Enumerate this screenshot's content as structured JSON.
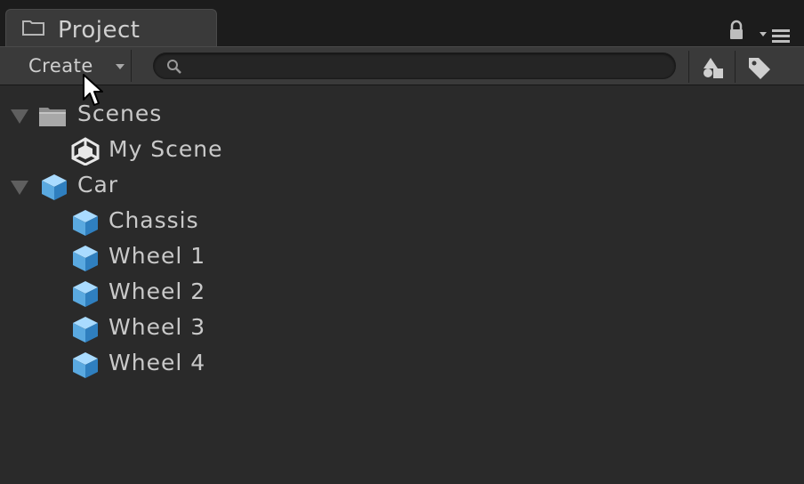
{
  "tab": {
    "title": "Project",
    "icon": "folder-icon"
  },
  "header_icons": [
    "lock-icon",
    "panel-menu-icon"
  ],
  "toolbar": {
    "create_label": "Create",
    "search": {
      "value": "",
      "placeholder": ""
    },
    "buttons": [
      "filter-by-type-icon",
      "filter-by-label-icon"
    ]
  },
  "tree": [
    {
      "label": "Scenes",
      "icon": "folder-icon",
      "level": 0,
      "expanded": true
    },
    {
      "label": "My Scene",
      "icon": "unity-scene-icon",
      "level": 1
    },
    {
      "label": "Car",
      "icon": "prefab-cube-icon",
      "level": 0,
      "expanded": true
    },
    {
      "label": "Chassis",
      "icon": "prefab-cube-icon",
      "level": 1
    },
    {
      "label": "Wheel 1",
      "icon": "prefab-cube-icon",
      "level": 1
    },
    {
      "label": "Wheel 2",
      "icon": "prefab-cube-icon",
      "level": 1
    },
    {
      "label": "Wheel 3",
      "icon": "prefab-cube-icon",
      "level": 1
    },
    {
      "label": "Wheel 4",
      "icon": "prefab-cube-icon",
      "level": 1
    }
  ],
  "colors": {
    "background": "#2a2a2a",
    "toolbar": "#3a3a3a",
    "text": "#c9c9c9",
    "cube": "#5fb3e8"
  }
}
